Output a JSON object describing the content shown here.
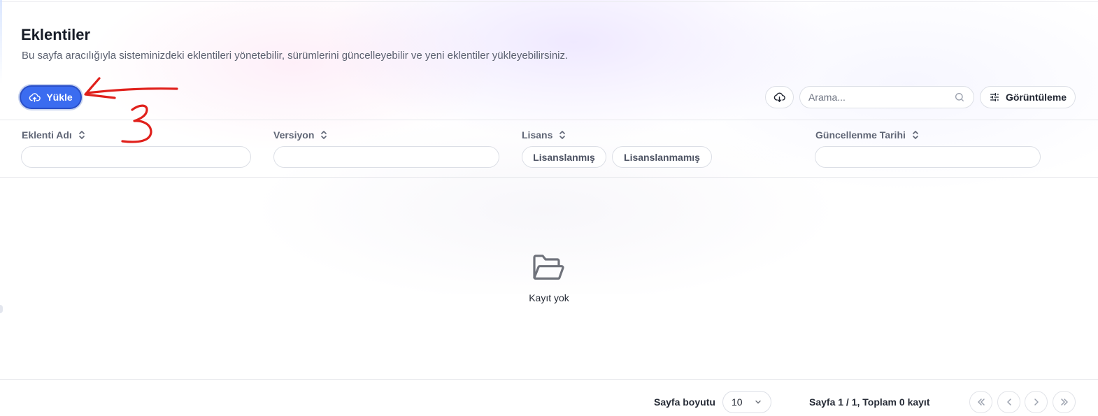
{
  "header": {
    "title": "Eklentiler",
    "subtitle": "Bu sayfa aracılığıyla sisteminizdeki eklentileri yönetebilir, sürümlerini güncelleyebilir ve yeni eklentiler yükleyebilirsiniz."
  },
  "toolbar": {
    "upload_label": "Yükle",
    "upload_icon": "cloud-upload-icon",
    "download_icon": "cloud-download-icon",
    "search_placeholder": "Arama...",
    "search_value": "",
    "view_label": "Görüntüleme",
    "view_icon": "sliders-icon"
  },
  "columns": [
    {
      "label": "Eklenti Adı",
      "filter_value": ""
    },
    {
      "label": "Versiyon",
      "filter_value": ""
    },
    {
      "label": "Lisans",
      "chips": [
        "Lisanslanmış",
        "Lisanslanmamış"
      ]
    },
    {
      "label": "Güncellenme Tarihi",
      "filter_value": ""
    }
  ],
  "empty_state": {
    "icon": "folder-open-icon",
    "text": "Kayıt yok"
  },
  "pagination": {
    "page_size_label": "Sayfa boyutu",
    "page_size_value": "10",
    "page_info": "Sayfa 1 / 1, Toplam 0 kayıt"
  },
  "annotation": {
    "number": "3",
    "color": "#e0201b"
  },
  "colors": {
    "primary": "#3b6cf0",
    "annotation": "#e0201b"
  }
}
